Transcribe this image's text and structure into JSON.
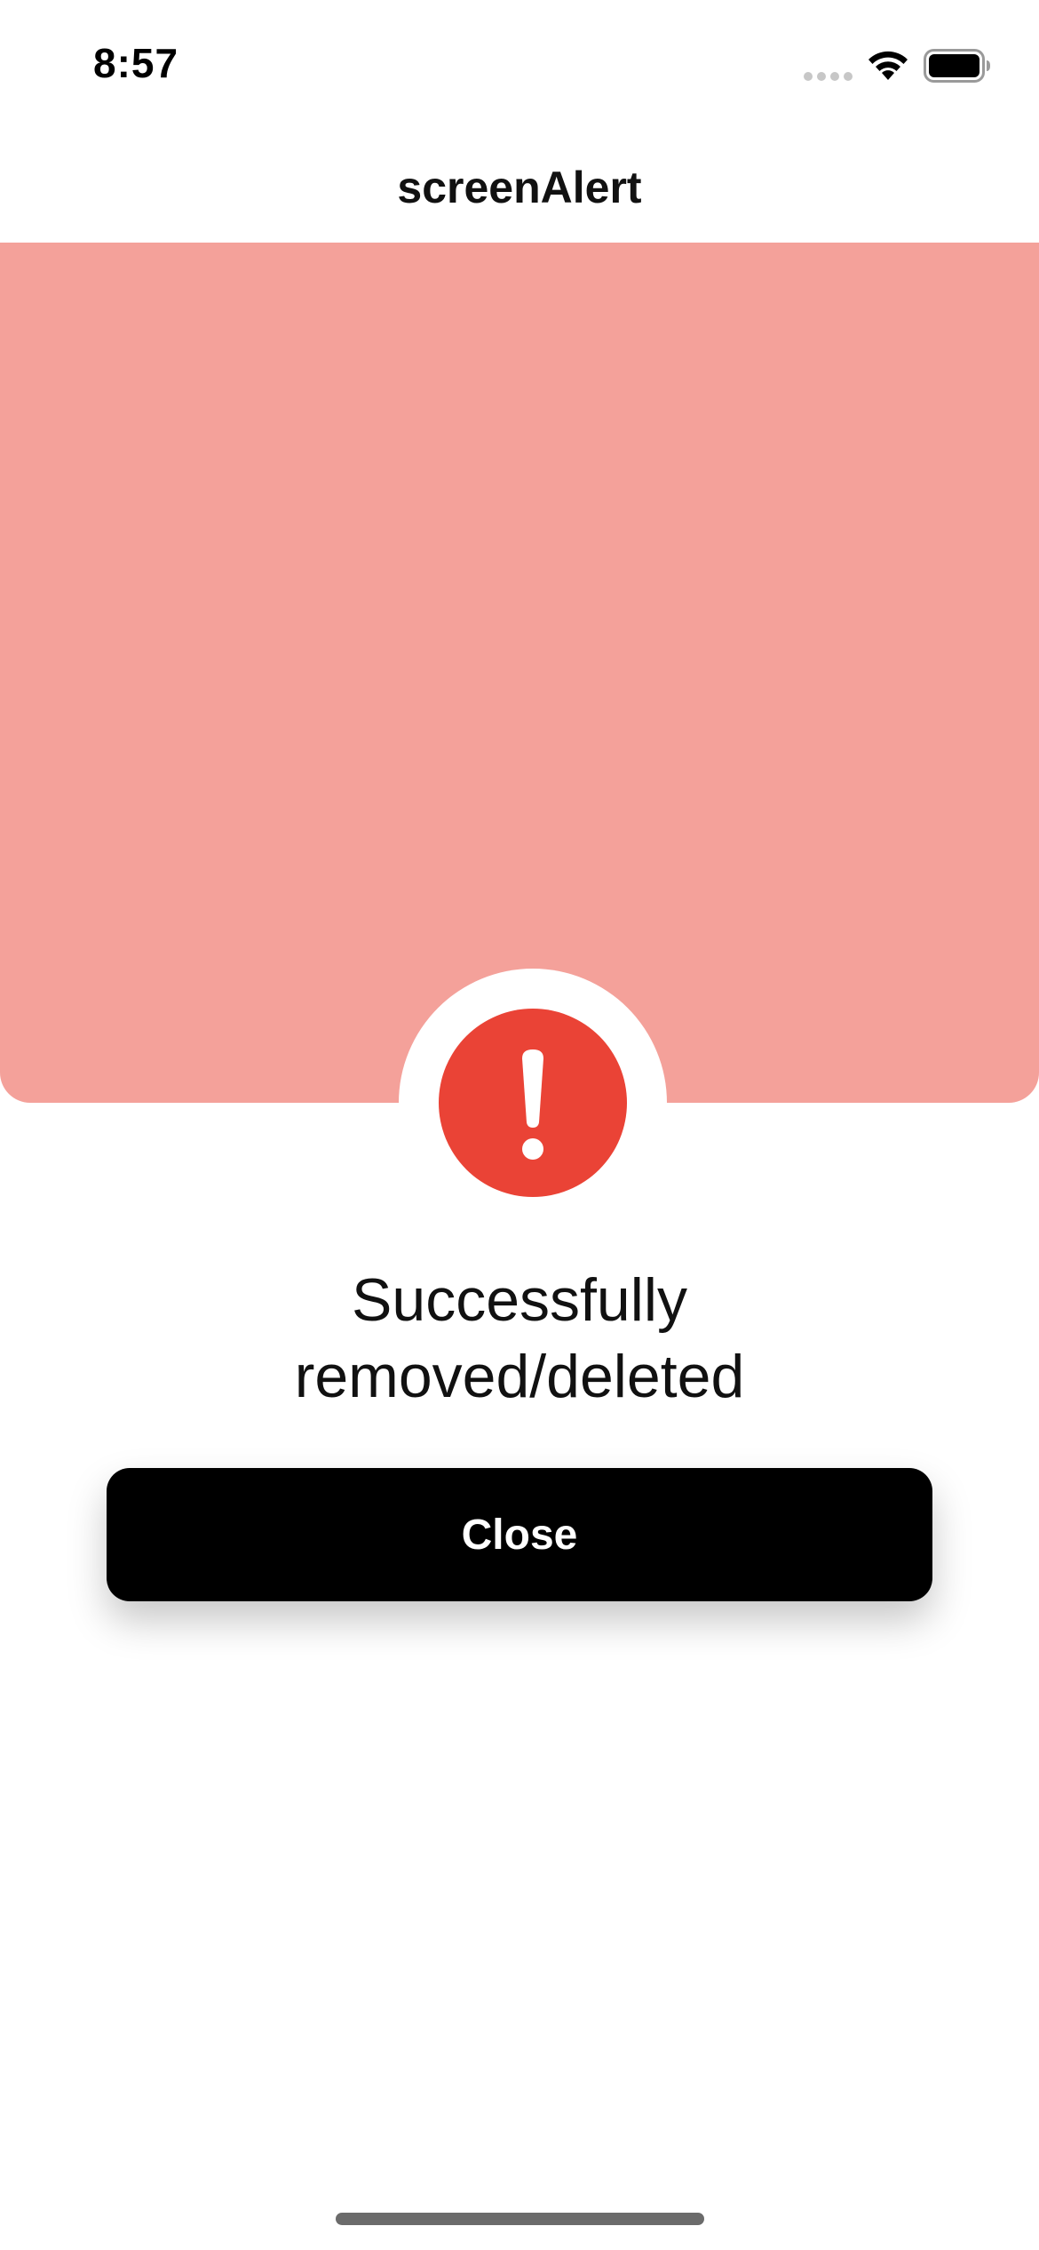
{
  "status_bar": {
    "time": "8:57"
  },
  "nav": {
    "title": "screenAlert"
  },
  "alert": {
    "icon": "exclamation-icon",
    "message_line1": "Successfully",
    "message_line2": "removed/deleted",
    "close_label": "Close"
  },
  "colors": {
    "panel": "#f4a19a",
    "icon_circle": "#ea4336",
    "button": "#000000"
  }
}
